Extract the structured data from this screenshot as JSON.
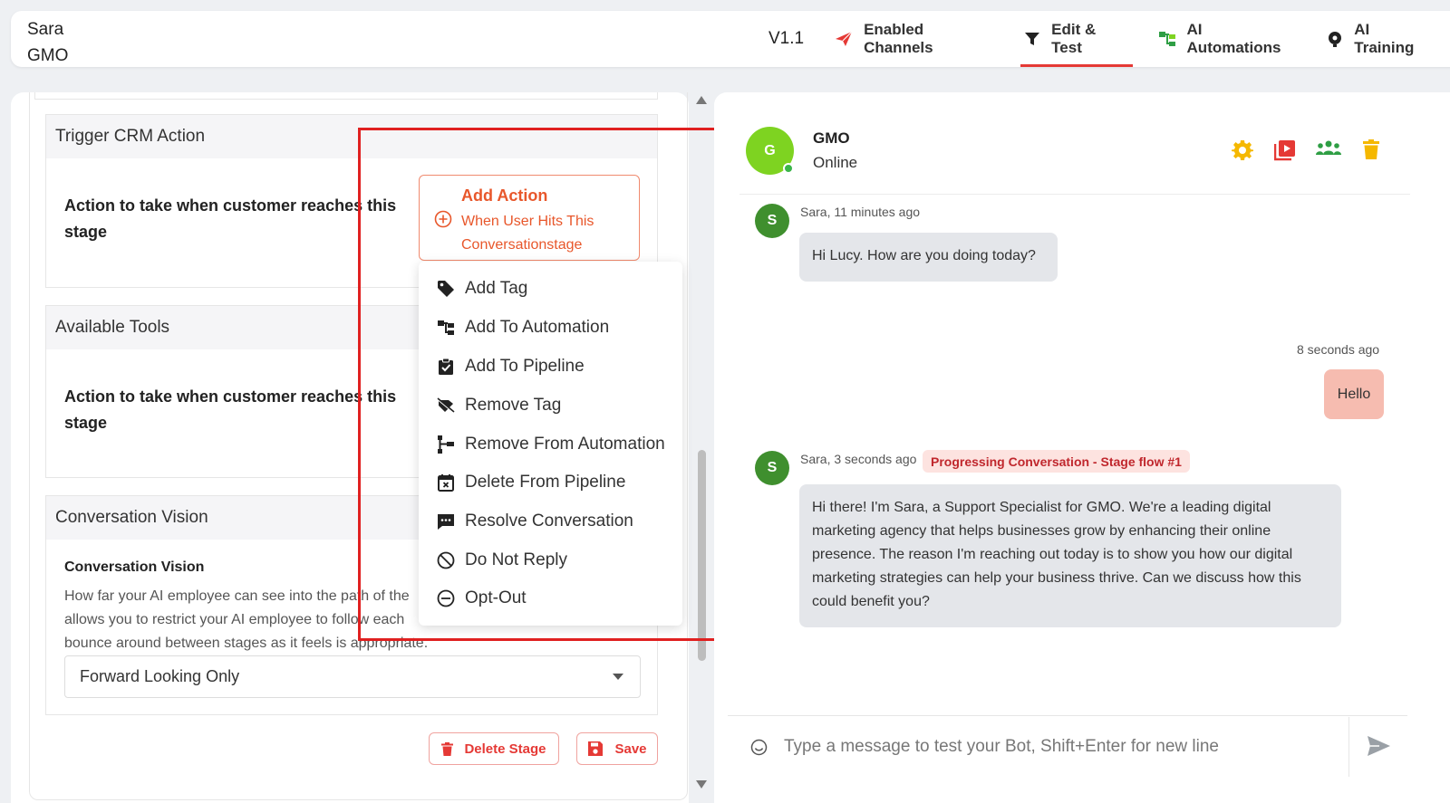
{
  "header": {
    "user_name": "Sara",
    "org_name": "GMO",
    "version": "V1.1",
    "nav": [
      {
        "label": "Enabled Channels",
        "icon": "paper-plane-icon"
      },
      {
        "label": "Edit & Test",
        "icon": "funnel-icon",
        "active": true
      },
      {
        "label": "AI Automations",
        "icon": "automation-icon"
      },
      {
        "label": "AI Training",
        "icon": "brain-icon"
      }
    ]
  },
  "stage_editor": {
    "trigger_crm": {
      "title": "Trigger CRM Action",
      "label": "Action to take when customer reaches this stage",
      "add_action": {
        "title": "Add Action",
        "subtitle_line1": "When User Hits This",
        "subtitle_line2": "Conversationstage"
      }
    },
    "available_tools": {
      "title": "Available Tools",
      "label": "Action to take when customer reaches this stage"
    },
    "conversation_vision": {
      "title": "Conversation Vision",
      "field_title": "Conversation Vision",
      "description_line1": "How far your AI employee can see into the path of the",
      "description_line2": "allows you to restrict your AI employee to follow each",
      "description_line3": "bounce around between stages as it feels is appropriate.",
      "selected": "Forward Looking Only"
    },
    "buttons": {
      "delete": "Delete Stage",
      "save": "Save"
    }
  },
  "action_menu": {
    "items": [
      {
        "label": "Add Tag",
        "icon": "tag-icon"
      },
      {
        "label": "Add To Automation",
        "icon": "automation-icon"
      },
      {
        "label": "Add To Pipeline",
        "icon": "clipboard-check-icon"
      },
      {
        "label": "Remove Tag",
        "icon": "tag-off-icon"
      },
      {
        "label": "Remove From Automation",
        "icon": "automation-remove-icon"
      },
      {
        "label": "Delete From Pipeline",
        "icon": "calendar-x-icon"
      },
      {
        "label": "Resolve Conversation",
        "icon": "chat-dots-icon"
      },
      {
        "label": "Do Not Reply",
        "icon": "ban-icon"
      },
      {
        "label": "Opt-Out",
        "icon": "minus-circle-icon"
      }
    ]
  },
  "chat": {
    "bot": {
      "initial": "G",
      "name": "GMO",
      "status": "Online"
    },
    "messages": [
      {
        "sender_initial": "S",
        "meta": "Sara, 11 minutes ago",
        "text": "Hi Lucy. How are you doing today?"
      },
      {
        "meta": "8 seconds ago",
        "text": "Hello"
      },
      {
        "sender_initial": "S",
        "meta": "Sara, 3 seconds ago",
        "badge": "Progressing Conversation - Stage flow #1",
        "line1": "Hi there! I'm Sara, a Support Specialist for GMO. We're a leading digital",
        "line2": "marketing agency that helps businesses grow by enhancing their online",
        "line3": "presence. The reason I'm reaching out today is to show you how our digital",
        "line4": "marketing strategies can help your business thrive. Can we discuss how this",
        "line5": "could benefit you?"
      }
    ],
    "input_placeholder": "Type a message to test your Bot, Shift+Enter for new line"
  },
  "colors": {
    "accent": "#e53935",
    "action": "#e8572b",
    "green": "#7ed321",
    "user_bubble": "#f6bcb0"
  }
}
